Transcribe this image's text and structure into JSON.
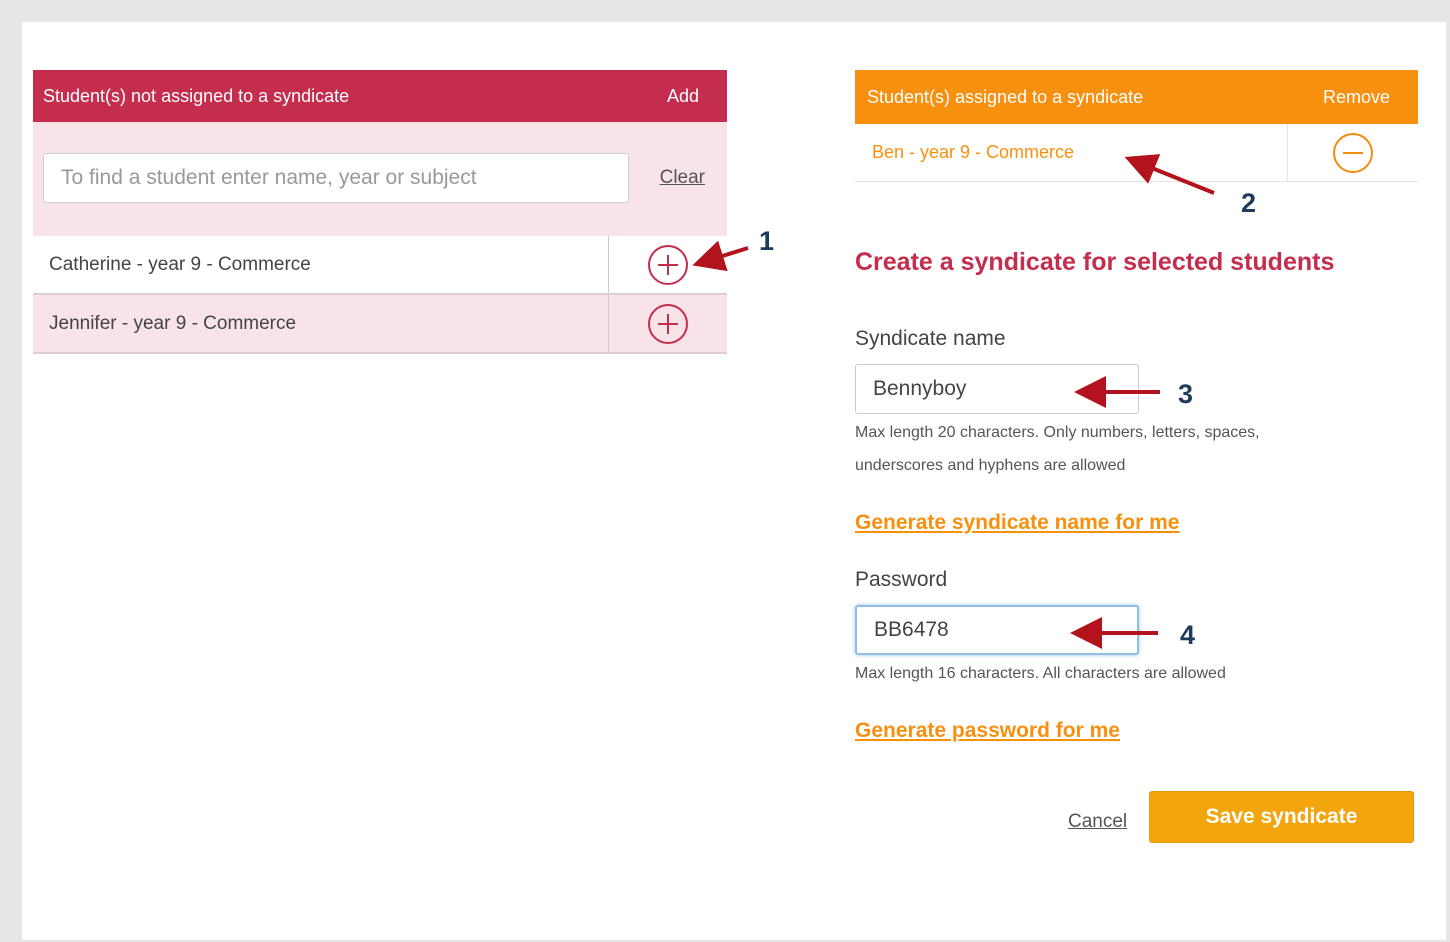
{
  "unassigned": {
    "header_title": "Student(s) not assigned to a syndicate",
    "header_action": "Add",
    "search_placeholder": "To find a student enter name, year or subject",
    "search_value": "",
    "clear_label": "Clear",
    "students": [
      {
        "label": "Catherine - year 9 - Commerce",
        "action_icon": "plus-circle-icon"
      },
      {
        "label": "Jennifer - year 9 - Commerce",
        "action_icon": "plus-circle-icon"
      }
    ]
  },
  "assigned": {
    "header_title": "Student(s) assigned to a syndicate",
    "header_action": "Remove",
    "students": [
      {
        "label": "Ben - year 9 - Commerce",
        "action_icon": "minus-circle-icon"
      }
    ]
  },
  "form": {
    "title": "Create a syndicate for selected students",
    "name_label": "Syndicate name",
    "name_value": "Bennyboy",
    "name_hint": "Max length 20 characters. Only numbers, letters, spaces, underscores and hyphens are allowed",
    "generate_name_link": "Generate syndicate name for me",
    "password_label": "Password",
    "password_value": "BB6478",
    "password_hint": "Max length 16 characters. All characters are allowed",
    "generate_password_link": "Generate password for me",
    "cancel_label": "Cancel",
    "save_label": "Save syndicate"
  },
  "annotations": [
    "1",
    "2",
    "3",
    "4"
  ],
  "colors": {
    "unassigned_accent": "#c42d4d",
    "assigned_accent": "#f7900f",
    "save_button": "#f2a50c",
    "annotation_arrow": "#b3131c"
  }
}
